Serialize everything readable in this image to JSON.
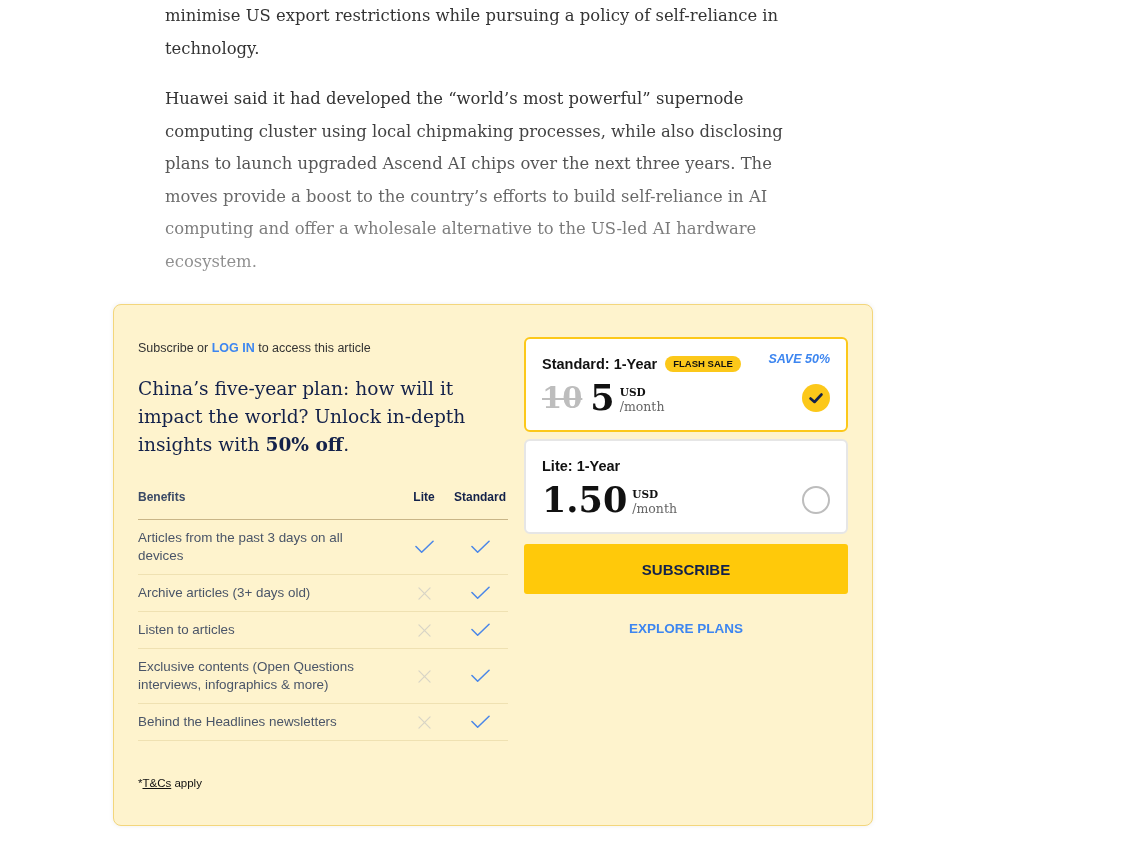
{
  "article": {
    "paragraphs": [
      "minimise US export restrictions while pursuing a policy of self-reliance in technology.",
      "Huawei said it had developed the “world’s most powerful” supernode computing cluster using local chipmaking processes, while also disclosing plans to launch upgraded Ascend AI chips over the next three years. The moves provide a boost to the country’s efforts to build self-reliance in AI computing and offer a wholesale alternative to the US-led AI hardware ecosystem."
    ]
  },
  "paywall": {
    "prompt": {
      "before": "Subscribe or",
      "link": "LOG IN",
      "after": "to access this article"
    },
    "headline": "China’s five-year plan: how will it impact the world? Unlock in-depth insights with **50% off**.",
    "benefits": {
      "columns": [
        "Benefits",
        "Lite",
        "Standard"
      ],
      "rows": [
        {
          "label": "Articles from the past 3 days on all devices",
          "lite": true,
          "standard": true
        },
        {
          "label": "Archive articles (3+ days old)",
          "lite": false,
          "standard": true
        },
        {
          "label": "Listen to articles",
          "lite": false,
          "standard": true
        },
        {
          "label": "Exclusive contents (Open Questions interviews, infographics & more)",
          "lite": false,
          "standard": true
        },
        {
          "label": "Behind the Headlines newsletters",
          "lite": false,
          "standard": true
        }
      ]
    },
    "footnote": {
      "prefix": "*",
      "link": "T&Cs",
      "suffix": "apply"
    },
    "plans": [
      {
        "name": "Standard: 1-Year",
        "badge": "FLASH SALE",
        "save": "SAVE 50%",
        "old_price": "10",
        "price": "5",
        "currency": "USD",
        "period": "/month",
        "selected": true
      },
      {
        "name": "Lite: 1-Year",
        "price": "1.50",
        "currency": "USD",
        "period": "/month",
        "selected": false
      }
    ],
    "subscribe_button": "SUBSCRIBE",
    "explore_link": "EXPLORE PLANS"
  }
}
